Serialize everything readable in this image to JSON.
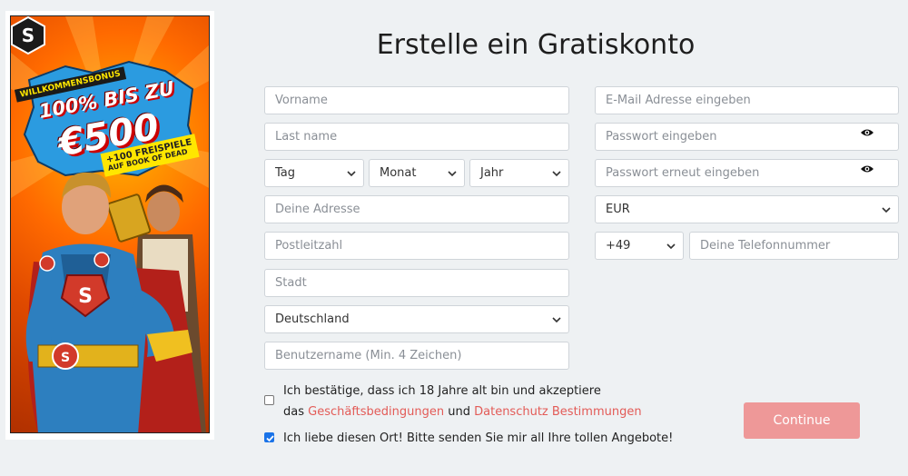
{
  "page": {
    "title": "Erstelle ein Gratiskonto"
  },
  "banner": {
    "label": "WILLKOMMENSBONUS",
    "headline": "100% BIS ZU",
    "amount": "€500",
    "freespins": "+100 FREISPIELE",
    "freespins_game": "AUF BOOK OF DEAD"
  },
  "form": {
    "first_name_placeholder": "Vorname",
    "last_name_placeholder": "Last name",
    "day_label": "Tag",
    "month_label": "Monat",
    "year_label": "Jahr",
    "address_placeholder": "Deine Adresse",
    "postcode_placeholder": "Postleitzahl",
    "city_placeholder": "Stadt",
    "country_value": "Deutschland",
    "username_placeholder": "Benutzername (Min. 4 Zeichen)",
    "email_placeholder": "E-Mail Adresse eingeben",
    "password_placeholder": "Passwort eingeben",
    "password_repeat_placeholder": "Passwort erneut eingeben",
    "currency_value": "EUR",
    "phone_prefix_value": "+49",
    "phone_placeholder": "Deine Telefonnummer"
  },
  "consent": {
    "age_line1": "Ich bestätige, dass ich 18 Jahre alt bin und akzeptiere",
    "age_prefix": "das ",
    "terms_link": "Geschäftsbedingungen",
    "and_word": " und ",
    "privacy_link": "Datenschutz Bestimmungen",
    "age_checked": false,
    "marketing_text": "Ich liebe diesen Ort! Bitte senden Sie mir all Ihre tollen Angebote!",
    "marketing_checked": true
  },
  "actions": {
    "continue_label": "Continue"
  },
  "colors": {
    "link": "#e35b57",
    "button": "#ee9898",
    "checkbox": "#1a73e8",
    "background": "#eef1f3"
  }
}
